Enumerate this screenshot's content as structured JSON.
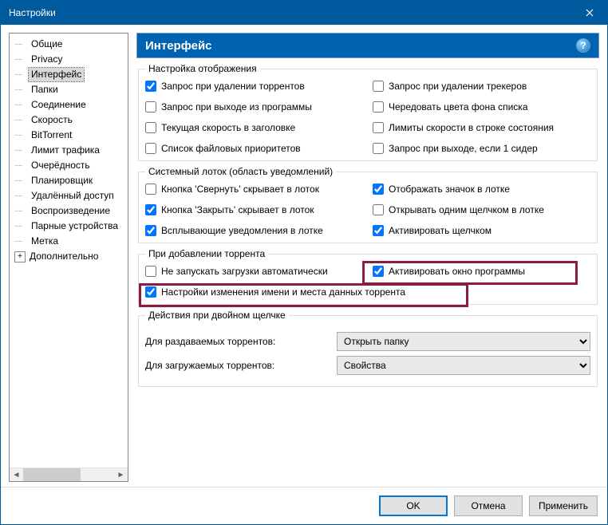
{
  "window": {
    "title": "Настройки"
  },
  "sidebar": {
    "items": [
      {
        "label": "Общие"
      },
      {
        "label": "Privacy"
      },
      {
        "label": "Интерфейс",
        "selected": true
      },
      {
        "label": "Папки"
      },
      {
        "label": "Соединение"
      },
      {
        "label": "Скорость"
      },
      {
        "label": "BitTorrent"
      },
      {
        "label": "Лимит трафика"
      },
      {
        "label": "Очерёдность"
      },
      {
        "label": "Планировщик"
      },
      {
        "label": "Удалённый доступ"
      },
      {
        "label": "Воспроизведение"
      },
      {
        "label": "Парные устройства"
      },
      {
        "label": "Метка"
      },
      {
        "label": "Дополнительно",
        "expandable": true
      }
    ]
  },
  "main": {
    "title": "Интерфейс",
    "help_glyph": "?",
    "groups": {
      "display": {
        "legend": "Настройка отображения",
        "items": [
          {
            "label": "Запрос при удалении торрентов",
            "checked": true
          },
          {
            "label": "Запрос при удалении трекеров",
            "checked": false
          },
          {
            "label": "Запрос при выходе из программы",
            "checked": false
          },
          {
            "label": "Чередовать цвета фона списка",
            "checked": false
          },
          {
            "label": "Текущая скорость в заголовке",
            "checked": false
          },
          {
            "label": "Лимиты скорости в строке состояния",
            "checked": false
          },
          {
            "label": "Список файловых приоритетов",
            "checked": false
          },
          {
            "label": "Запрос при выходе, если 1 сидер",
            "checked": false
          }
        ]
      },
      "tray": {
        "legend": "Системный лоток (область уведомлений)",
        "items": [
          {
            "label": "Кнопка 'Свернуть' скрывает в лоток",
            "checked": false
          },
          {
            "label": "Отображать значок в лотке",
            "checked": true
          },
          {
            "label": "Кнопка 'Закрыть' скрывает в лоток",
            "checked": true
          },
          {
            "label": "Открывать одним щелчком в лотке",
            "checked": false
          },
          {
            "label": "Всплывающие уведомления в лотке",
            "checked": true
          },
          {
            "label": "Активировать щелчком",
            "checked": true
          }
        ]
      },
      "add": {
        "legend": "При добавлении торрента",
        "items": [
          {
            "label": "Не запускать загрузки автоматически",
            "checked": false
          },
          {
            "label": "Активировать окно программы",
            "checked": true
          },
          {
            "label": "Настройки изменения имени и места данных торрента",
            "checked": true
          }
        ]
      },
      "dblclick": {
        "legend": "Действия при двойном щелчке",
        "row1_label": "Для раздаваемых торрентов:",
        "row1_value": "Открыть папку",
        "row2_label": "Для загружаемых торрентов:",
        "row2_value": "Свойства"
      }
    }
  },
  "footer": {
    "ok": "OK",
    "cancel": "Отмена",
    "apply": "Применить"
  }
}
